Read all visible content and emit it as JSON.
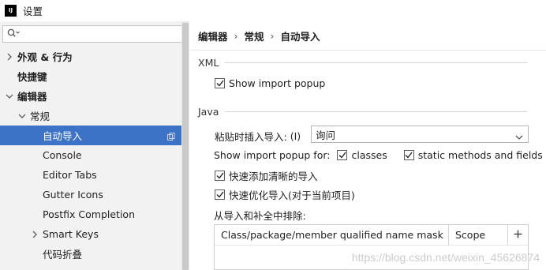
{
  "window": {
    "title": "设置",
    "app_icon_text": "IJ"
  },
  "sidebar": {
    "search": {
      "value": "",
      "placeholder": ""
    },
    "items": [
      {
        "label": "外观 & 行为"
      },
      {
        "label": "快捷键"
      },
      {
        "label": "编辑器"
      },
      {
        "label": "常规"
      },
      {
        "label": "自动导入"
      },
      {
        "label": "Console"
      },
      {
        "label": "Editor Tabs"
      },
      {
        "label": "Gutter Icons"
      },
      {
        "label": "Postfix Completion"
      },
      {
        "label": "Smart Keys"
      },
      {
        "label": "代码折叠"
      }
    ]
  },
  "breadcrumb": {
    "items": [
      "编辑器",
      "常规",
      "自动导入"
    ]
  },
  "xml_section": {
    "title": "XML",
    "show_import_popup": {
      "label": "Show import popup",
      "checked": true
    }
  },
  "java_section": {
    "title": "Java",
    "paste_insert_label": "粘贴时插入导入:",
    "paste_insert_mnemonic": "(I)",
    "paste_insert_value": "询问",
    "show_popup_for_label": "Show import popup for:",
    "classes": {
      "label": "classes",
      "checked": true
    },
    "static_methods": {
      "label": "static methods and fields",
      "checked": true
    },
    "add_unambiguous": {
      "label": "快速添加清晰的导入",
      "checked": true
    },
    "optimize_imports": {
      "label": "快速优化导入(对于当前项目)",
      "checked": true
    },
    "exclude_label": "从导入和补全中排除:",
    "table": {
      "columns": [
        "Class/package/member qualified name mask",
        "Scope"
      ],
      "add_label": "+"
    }
  },
  "watermark": "https://blog.csdn.net/weixin_45626874",
  "colors": {
    "selection": "#3d73c7",
    "sidebar_bg": "#f2f2f2"
  }
}
